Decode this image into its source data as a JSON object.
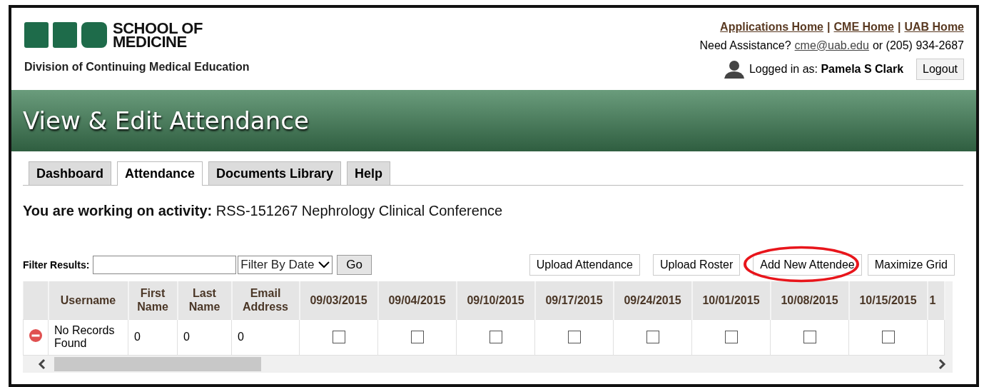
{
  "header": {
    "logo_line1": "SCHOOL OF",
    "logo_line2": "MEDICINE",
    "division": "Division of Continuing Medical Education",
    "links": [
      "Applications Home",
      "CME Home",
      "UAB Home"
    ],
    "link_separator": "|",
    "assistance": {
      "prefix": "Need Assistance?",
      "email": "cme@uab.edu",
      "suffix": "or (205) 934-2687"
    },
    "logged_in": {
      "label": "Logged in as:",
      "user": "Pamela S Clark"
    },
    "logout": "Logout"
  },
  "banner": {
    "title": "View & Edit Attendance"
  },
  "tabs": [
    {
      "label": "Dashboard",
      "selected": false
    },
    {
      "label": "Attendance",
      "selected": true
    },
    {
      "label": "Documents Library",
      "selected": false
    },
    {
      "label": "Help",
      "selected": false
    }
  ],
  "activity": {
    "label": "You are working on activity:",
    "value": "RSS-151267 Nephrology Clinical Conference"
  },
  "filter": {
    "label": "Filter Results:",
    "select": "Filter By Date",
    "go": "Go"
  },
  "actions": [
    {
      "label": "Upload Attendance",
      "circled": false
    },
    {
      "label": "Upload Roster",
      "circled": false
    },
    {
      "label": "Add New Attendee",
      "circled": true
    },
    {
      "label": "Maximize Grid",
      "circled": false
    }
  ],
  "table": {
    "columns": [
      "Username",
      "First Name",
      "Last Name",
      "Email Address",
      "09/03/2015",
      "09/04/2015",
      "09/10/2015",
      "09/17/2015",
      "09/24/2015",
      "10/01/2015",
      "10/08/2015",
      "10/15/2015",
      "1"
    ],
    "rows": [
      {
        "cells": [
          "No Records Found",
          "0",
          "0",
          "0"
        ],
        "attendance": [
          {
            "checked": false
          },
          {
            "checked": false
          },
          {
            "checked": false
          },
          {
            "checked": false
          },
          {
            "checked": false
          },
          {
            "checked": false
          },
          {
            "checked": false
          },
          {
            "checked": false
          }
        ]
      }
    ]
  }
}
